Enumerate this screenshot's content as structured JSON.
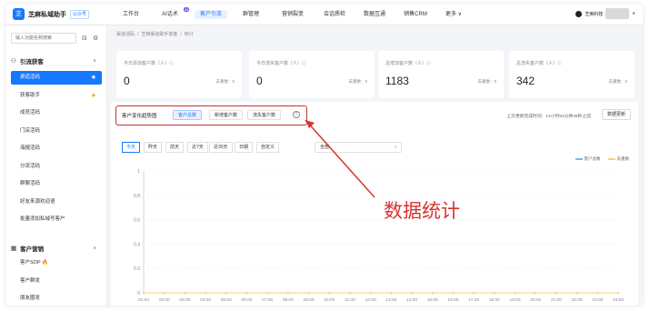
{
  "app": {
    "name": "芝麻私域助手",
    "badge": "公众号"
  },
  "nav": [
    {
      "label": "工作台",
      "active": false,
      "badge": ""
    },
    {
      "label": "AI话术",
      "active": false,
      "badge": "AI"
    },
    {
      "label": "客户引流",
      "active": true,
      "badge": ""
    },
    {
      "label": "群管理",
      "active": false,
      "badge": ""
    },
    {
      "label": "营销裂变",
      "active": false,
      "badge": ""
    },
    {
      "label": "会话质检",
      "active": false,
      "badge": ""
    },
    {
      "label": "数据互通",
      "active": false,
      "badge": ""
    },
    {
      "label": "销售CRM",
      "active": false,
      "badge": ""
    },
    {
      "label": "更多 ∨",
      "active": false,
      "badge": ""
    }
  ],
  "user": {
    "name": "芝麻科技"
  },
  "sidebar": {
    "search_placeholder": "输入功能名称搜索",
    "group1": "引流获客",
    "items1": [
      {
        "label": "渠道活码",
        "active": true,
        "star": true
      },
      {
        "label": "获客助手",
        "active": false,
        "star": true
      },
      {
        "label": "成员活码",
        "active": false,
        "star": false
      },
      {
        "label": "门店活码",
        "active": false,
        "star": false
      },
      {
        "label": "海报活码",
        "active": false,
        "star": false
      },
      {
        "label": "分流活码",
        "active": false,
        "star": false
      },
      {
        "label": "群聊活码",
        "active": false,
        "star": false
      },
      {
        "label": "好友来源欢迎语",
        "active": false,
        "star": false
      },
      {
        "label": "批量添加私域号客户",
        "active": false,
        "star": false
      }
    ],
    "group2": "客户营销",
    "items2": [
      {
        "label": "客户SOP 🔥",
        "active": false
      },
      {
        "label": "客户群发",
        "active": false
      },
      {
        "label": "朋友圈发",
        "active": false
      }
    ]
  },
  "breadcrumb": [
    "渠道活码",
    "/",
    "芝麻渠道助手答客",
    "/",
    "统计"
  ],
  "stats": [
    {
      "label": "今日添加客户数（人）ⓘ",
      "value": "0",
      "sub": "去重数：0"
    },
    {
      "label": "今日流失客户数（人）ⓘ",
      "value": "0",
      "sub": "去重数：0"
    },
    {
      "label": "总增加客户数（人）ⓘ",
      "value": "1183",
      "sub": "去重数：0"
    },
    {
      "label": "总流失客户数（人）ⓘ",
      "value": "342",
      "sub": "去重数：0"
    }
  ],
  "panel": {
    "title": "客户变化趋势图",
    "tabs": [
      "客户总数",
      "新增客户数",
      "流失客户数"
    ],
    "info": "?",
    "last_update": "上次更新完成时间：14小时54分钟48秒之前",
    "refresh": "数据更新",
    "filters": [
      "今天",
      "昨天",
      "前天",
      "近7天",
      "近30天",
      "日期",
      "自定义"
    ],
    "select_value": "全部",
    "legend": [
      {
        "name": "客户总数",
        "color": "#7eb8f7"
      },
      {
        "name": "去重数",
        "color": "#f2d36b"
      }
    ]
  },
  "chart_data": {
    "type": "line",
    "x": [
      "01:00",
      "02:00",
      "03:00",
      "04:00",
      "05:00",
      "06:00",
      "07:00",
      "08:00",
      "09:00",
      "10:00",
      "11:00",
      "12:00",
      "13:00",
      "14:00",
      "15:00",
      "16:00",
      "17:00",
      "18:00",
      "19:00",
      "20:00",
      "21:00",
      "22:00",
      "23:00",
      "23:59"
    ],
    "series": [
      {
        "name": "客户总数",
        "values": [
          0,
          0,
          0,
          0,
          0,
          0,
          0,
          0,
          0,
          0,
          0,
          0,
          0,
          0,
          0,
          0,
          0,
          0,
          0,
          0,
          0,
          0,
          0,
          0
        ],
        "color": "#7eb8f7"
      },
      {
        "name": "去重数",
        "values": [
          0,
          0,
          0,
          0,
          0,
          0,
          0,
          0,
          0,
          0,
          0,
          0,
          0,
          0,
          0,
          0,
          0,
          0,
          0,
          0,
          0,
          0,
          0,
          0
        ],
        "color": "#f2d36b"
      }
    ],
    "yticks": [
      "0",
      "0.2",
      "0.4",
      "0.6",
      "0.8",
      "1"
    ],
    "ylim": [
      0,
      1
    ],
    "grid": true,
    "legend": "top-right"
  },
  "annotation": "数据统计"
}
